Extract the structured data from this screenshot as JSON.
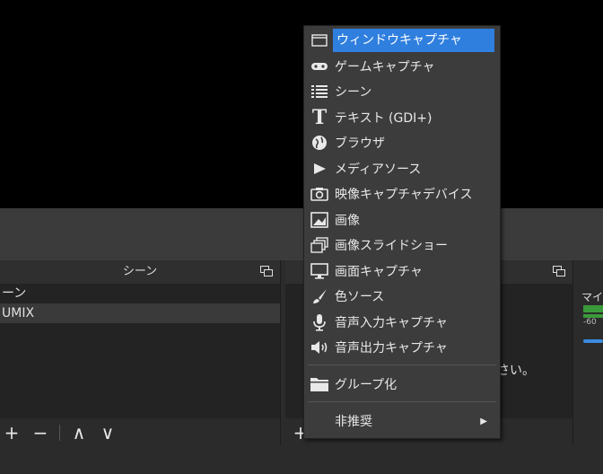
{
  "scenes_dock": {
    "title": "シーン",
    "scenes": [
      "ーン",
      "UMIX"
    ],
    "toolbar": {
      "add": "+",
      "remove": "−",
      "up": "∧",
      "down": "∨"
    }
  },
  "sources_dock": {
    "hint_text": "さい。"
  },
  "mixer_dock": {
    "label": "マイ",
    "meter_value": "-60"
  },
  "context_menu": {
    "items": [
      {
        "icon": "window-icon",
        "label": "ウィンドウキャプチャ",
        "highlighted": true
      },
      {
        "icon": "gamepad-icon",
        "label": "ゲームキャプチャ"
      },
      {
        "icon": "list-icon",
        "label": "シーン"
      },
      {
        "icon": "text-icon",
        "label": "テキスト (GDI+)"
      },
      {
        "icon": "globe-icon",
        "label": "ブラウザ"
      },
      {
        "icon": "play-icon",
        "label": "メディアソース"
      },
      {
        "icon": "camera-icon",
        "label": "映像キャプチャデバイス"
      },
      {
        "icon": "image-icon",
        "label": "画像"
      },
      {
        "icon": "slideshow-icon",
        "label": "画像スライドショー"
      },
      {
        "icon": "monitor-icon",
        "label": "画面キャプチャ"
      },
      {
        "icon": "brush-icon",
        "label": "色ソース"
      },
      {
        "icon": "microphone-icon",
        "label": "音声入力キャプチャ"
      },
      {
        "icon": "speaker-icon",
        "label": "音声出力キャプチャ"
      },
      {
        "icon": "folder-icon",
        "label": "グループ化"
      },
      {
        "label": "非推奨",
        "submenu": true
      }
    ]
  },
  "colors": {
    "highlight": "#2f7fde",
    "menu_bg": "#3c3c3c",
    "panel_bg": "#2b2b2b"
  }
}
